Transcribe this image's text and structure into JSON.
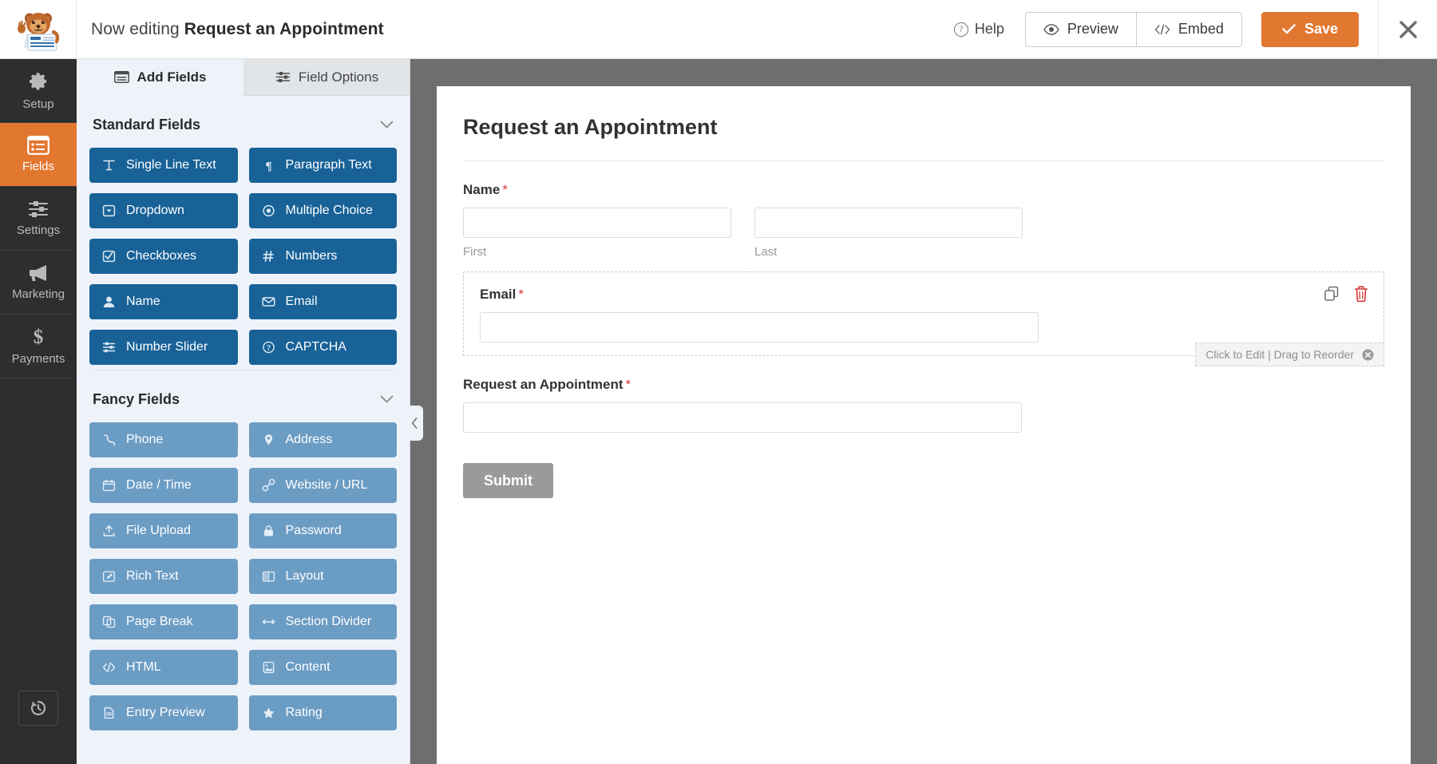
{
  "header": {
    "editing_prefix": "Now editing",
    "form_name": "Request an Appointment",
    "help_label": "Help",
    "preview_label": "Preview",
    "embed_label": "Embed",
    "save_label": "Save",
    "accent_color": "#e27730"
  },
  "rail": {
    "items": [
      {
        "label": "Setup",
        "icon": "gear-icon",
        "active": false
      },
      {
        "label": "Fields",
        "icon": "list-icon",
        "active": true
      },
      {
        "label": "Settings",
        "icon": "sliders-icon",
        "active": false
      },
      {
        "label": "Marketing",
        "icon": "megaphone-icon",
        "active": false
      },
      {
        "label": "Payments",
        "icon": "dollar-icon",
        "active": false
      }
    ],
    "history_icon": "revision-history-icon"
  },
  "panel": {
    "tabs": [
      {
        "label": "Add Fields",
        "icon": "add-fields-icon",
        "active": true
      },
      {
        "label": "Field Options",
        "icon": "field-options-icon",
        "active": false
      }
    ],
    "groups": [
      {
        "title": "Standard Fields",
        "pro": false,
        "fields": [
          {
            "label": "Single Line Text",
            "icon": "text-cursor-icon"
          },
          {
            "label": "Paragraph Text",
            "icon": "paragraph-icon"
          },
          {
            "label": "Dropdown",
            "icon": "dropdown-icon"
          },
          {
            "label": "Multiple Choice",
            "icon": "radio-icon"
          },
          {
            "label": "Checkboxes",
            "icon": "checkbox-icon"
          },
          {
            "label": "Numbers",
            "icon": "hash-icon"
          },
          {
            "label": "Name",
            "icon": "user-icon"
          },
          {
            "label": "Email",
            "icon": "envelope-icon"
          },
          {
            "label": "Number Slider",
            "icon": "sliders-icon"
          },
          {
            "label": "CAPTCHA",
            "icon": "captcha-icon"
          }
        ]
      },
      {
        "title": "Fancy Fields",
        "pro": true,
        "fields": [
          {
            "label": "Phone",
            "icon": "phone-icon"
          },
          {
            "label": "Address",
            "icon": "map-pin-icon"
          },
          {
            "label": "Date / Time",
            "icon": "calendar-icon"
          },
          {
            "label": "Website / URL",
            "icon": "link-icon"
          },
          {
            "label": "File Upload",
            "icon": "upload-icon"
          },
          {
            "label": "Password",
            "icon": "lock-icon"
          },
          {
            "label": "Rich Text",
            "icon": "pencil-square-icon"
          },
          {
            "label": "Layout",
            "icon": "columns-icon"
          },
          {
            "label": "Page Break",
            "icon": "page-break-icon"
          },
          {
            "label": "Section Divider",
            "icon": "arrows-horizontal-icon"
          },
          {
            "label": "HTML",
            "icon": "code-icon"
          },
          {
            "label": "Content",
            "icon": "image-doc-icon"
          },
          {
            "label": "Entry Preview",
            "icon": "document-icon"
          },
          {
            "label": "Rating",
            "icon": "star-icon"
          }
        ]
      }
    ]
  },
  "form": {
    "title": "Request an Appointment",
    "required_mark": "*",
    "fields": [
      {
        "label": "Name",
        "required": true,
        "type": "name",
        "sublabels": [
          "First",
          "Last"
        ],
        "values": [
          "",
          ""
        ]
      },
      {
        "label": "Email",
        "required": true,
        "type": "email",
        "value": "",
        "active": true,
        "hint": "Click to Edit | Drag to Reorder"
      },
      {
        "label": "Request an Appointment",
        "required": true,
        "type": "text",
        "value": ""
      }
    ],
    "submit_label": "Submit"
  }
}
